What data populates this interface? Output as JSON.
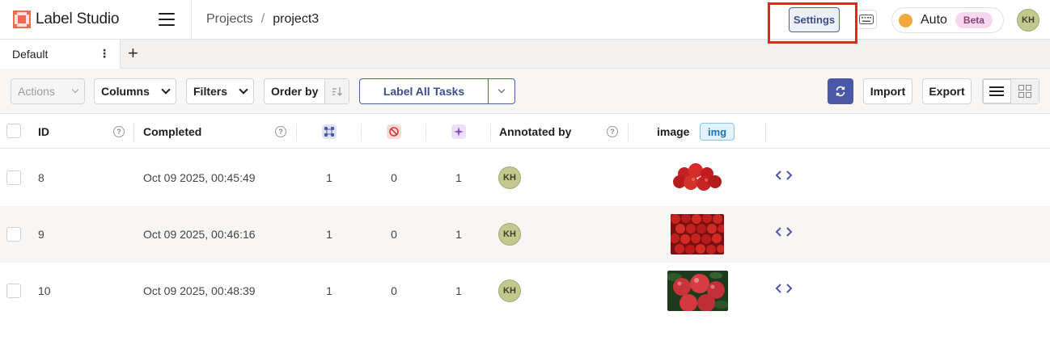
{
  "header": {
    "app_name": "Label Studio",
    "breadcrumb": {
      "projects": "Projects",
      "separator": "/",
      "current": "project3"
    },
    "settings_label": "Settings",
    "auto_label": "Auto",
    "beta_label": "Beta",
    "user_initials": "KH",
    "accent_color": "#4c5fa9",
    "highlight_color": "#e8241c"
  },
  "tabs": [
    {
      "label": "Default",
      "menu_glyph": "⋮"
    }
  ],
  "tab_add_glyph": "+",
  "toolbar": {
    "actions_label": "Actions",
    "columns_label": "Columns",
    "filters_label": "Filters",
    "order_by_label": "Order by",
    "label_all_label": "Label All Tasks",
    "import_label": "Import",
    "export_label": "Export",
    "view_mode": "list"
  },
  "table": {
    "columns": {
      "id": "ID",
      "completed": "Completed",
      "annotations_icon": "annotations-icon",
      "cancelled_icon": "cancelled-icon",
      "predictions_icon": "predictions-icon",
      "annotated_by": "Annotated by",
      "image": "image",
      "image_badge": "img"
    },
    "rows": [
      {
        "id": "8",
        "completed": "Oct 09 2025, 00:45:49",
        "annotations": "1",
        "cancelled": "0",
        "predictions": "1",
        "annotator": "KH",
        "image": "red apples"
      },
      {
        "id": "9",
        "completed": "Oct 09 2025, 00:46:16",
        "annotations": "1",
        "cancelled": "0",
        "predictions": "1",
        "annotator": "KH",
        "image": "apple pile"
      },
      {
        "id": "10",
        "completed": "Oct 09 2025, 00:48:39",
        "annotations": "1",
        "cancelled": "0",
        "predictions": "1",
        "annotator": "KH",
        "image": "apples with leaves"
      }
    ]
  }
}
